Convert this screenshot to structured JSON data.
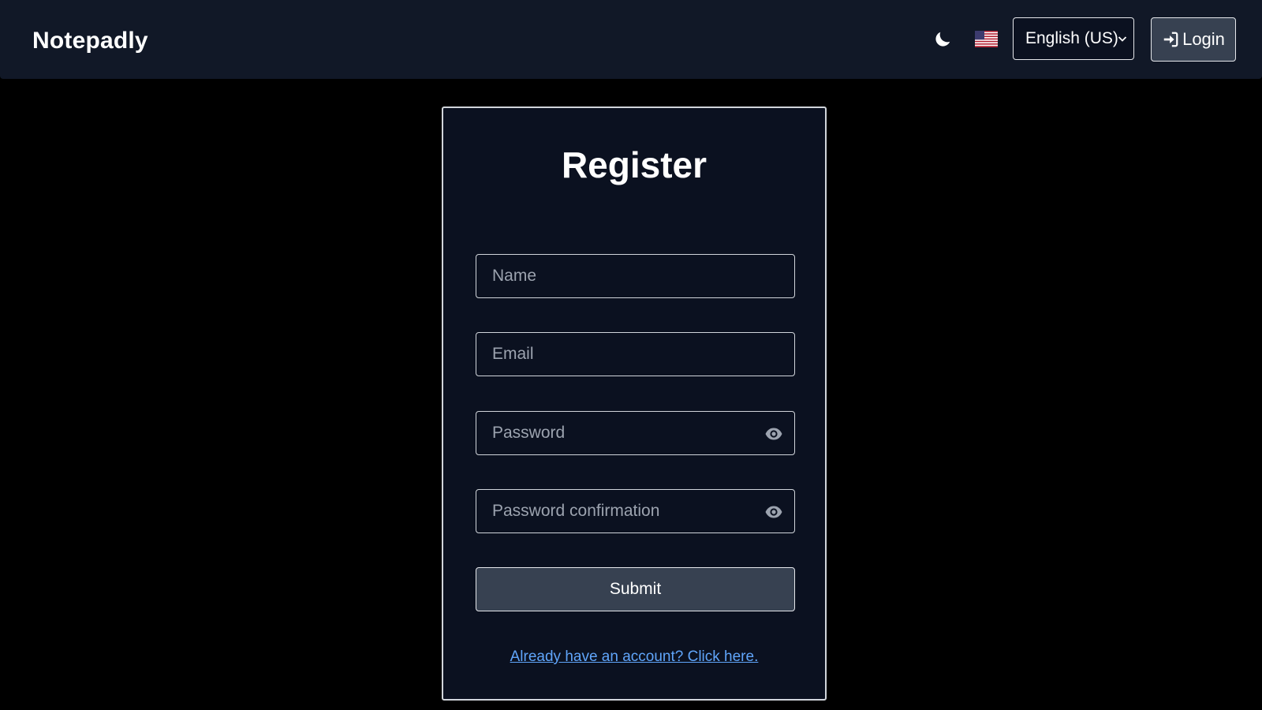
{
  "navbar": {
    "brand": "Notepadly",
    "theme_icon": "moon-icon",
    "flag_icon": "us-flag-icon",
    "language": {
      "selected": "English (US)"
    },
    "login": {
      "label": "Login",
      "icon": "sign-in-icon"
    }
  },
  "register": {
    "title": "Register",
    "fields": {
      "name": {
        "placeholder": "Name",
        "value": ""
      },
      "email": {
        "placeholder": "Email",
        "value": ""
      },
      "password": {
        "placeholder": "Password",
        "value": ""
      },
      "password_confirmation": {
        "placeholder": "Password confirmation",
        "value": ""
      }
    },
    "submit_label": "Submit",
    "signin_link": "Already have an account? Click here."
  },
  "colors": {
    "navbar_bg": "#111827",
    "page_bg": "#000000",
    "card_bg": "#0b1120",
    "button_bg": "#374151",
    "link": "#60a5fa"
  }
}
